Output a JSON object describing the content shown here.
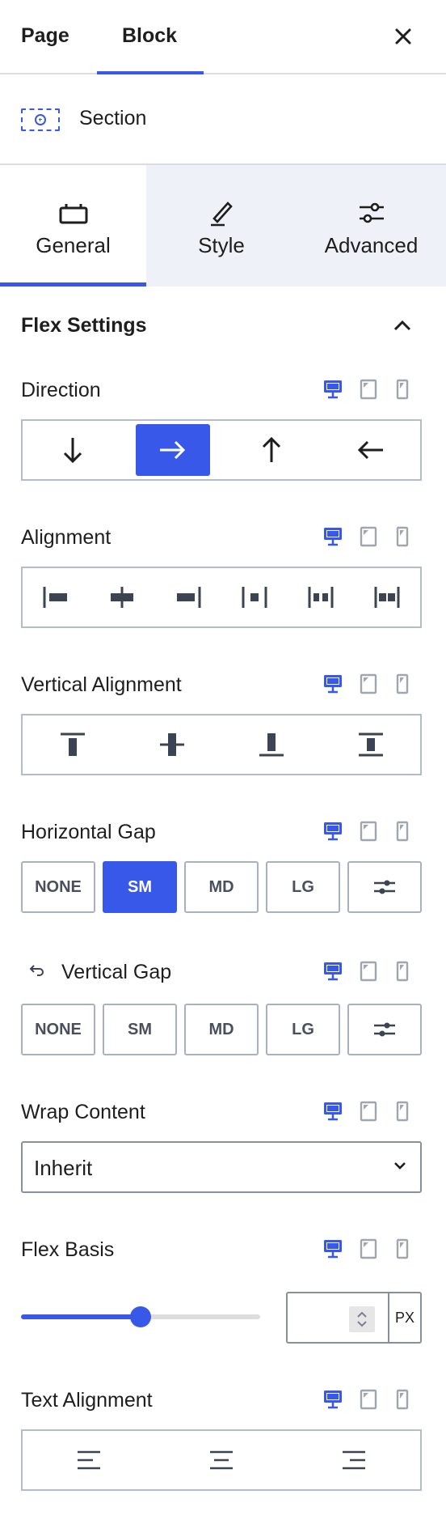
{
  "tabs": {
    "page": "Page",
    "block": "Block",
    "active": "Block"
  },
  "block": {
    "name": "Section"
  },
  "inspector_tabs": [
    {
      "label": "General",
      "icon": "tray-icon",
      "active": true
    },
    {
      "label": "Style",
      "icon": "brush-icon",
      "active": false
    },
    {
      "label": "Advanced",
      "icon": "sliders-icon",
      "active": false
    }
  ],
  "panel": {
    "title": "Flex Settings",
    "expanded": true
  },
  "controls": {
    "direction": {
      "label": "Direction",
      "options": [
        "down",
        "right",
        "up",
        "left"
      ],
      "selected": "right"
    },
    "alignment": {
      "label": "Alignment",
      "options": [
        "start",
        "center",
        "end",
        "space-between",
        "space-around",
        "space-evenly"
      ]
    },
    "vertical_alignment": {
      "label": "Vertical Alignment",
      "options": [
        "top",
        "center",
        "bottom",
        "stretch"
      ]
    },
    "horizontal_gap": {
      "label": "Horizontal Gap",
      "options": [
        "NONE",
        "SM",
        "MD",
        "LG"
      ],
      "selected": "SM"
    },
    "vertical_gap": {
      "label": "Vertical Gap",
      "options": [
        "NONE",
        "SM",
        "MD",
        "LG"
      ],
      "selected": ""
    },
    "wrap_content": {
      "label": "Wrap Content",
      "value": "Inherit"
    },
    "flex_basis": {
      "label": "Flex Basis",
      "value": "",
      "unit": "PX",
      "slider_fraction": 0.5
    },
    "text_alignment": {
      "label": "Text Alignment",
      "options": [
        "left",
        "center",
        "right"
      ]
    }
  },
  "colors": {
    "accent": "#3858e9",
    "device_inactive": "#a0a5b0",
    "border": "#b4bccb"
  },
  "device_icons": [
    "desktop-icon",
    "tablet-icon",
    "mobile-icon"
  ]
}
